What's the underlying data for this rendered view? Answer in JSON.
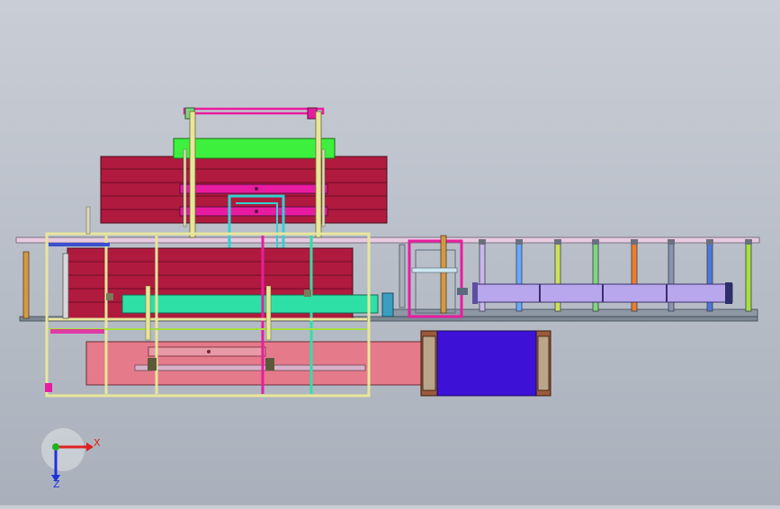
{
  "viewport": {
    "background_top": "#c9ced6",
    "background_bottom": "#a9b0bb"
  },
  "model": {
    "components": [
      "upper-crimson-panel-stack",
      "green-top-beam",
      "magenta-lifting-frame",
      "cyan-inner-bracket",
      "lower-crimson-panel-stack",
      "yellow-main-frame",
      "teal-bottom-beam",
      "pink-base-plate",
      "pink-outfeed-rail",
      "roller-conveyor",
      "lavender-conveyor-bed",
      "magenta-gate-frame",
      "blue-box",
      "brown-box-endcaps"
    ],
    "colors": {
      "crimson": "#b01a3f",
      "green": "#3ef03e",
      "magenta": "#e81ca0",
      "cyan": "#2fd3d3",
      "teal": "#2fe0a6",
      "yellow": "#e8e69a",
      "pink": "#e57a8a",
      "lavender": "#b9a7ee",
      "blue": "#3d12d6",
      "brown": "#9b5a3b",
      "rail": "#e7cbe0",
      "roller_colors": [
        "#c8b7e8",
        "#6aa9ff",
        "#cde05b",
        "#7ed67e",
        "#f07d2b",
        "#8a93b0",
        "#4d78d9",
        "#a5e03f"
      ]
    }
  },
  "triad": {
    "x_label": "X",
    "z_label": "Z",
    "x_color": "#e02020",
    "y_color": "#20b020",
    "z_color": "#2030e0"
  }
}
